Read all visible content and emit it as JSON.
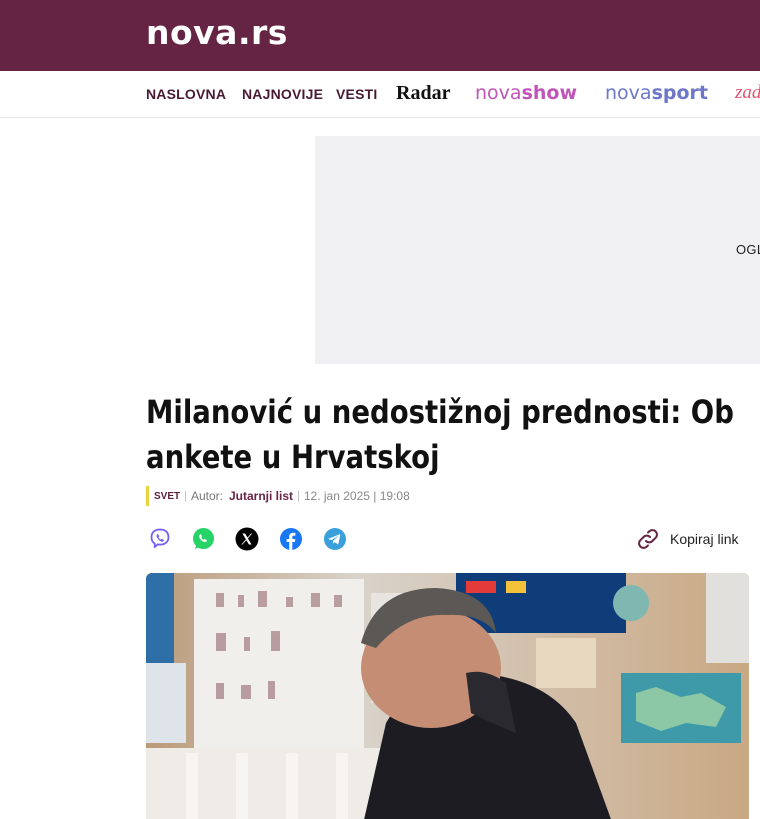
{
  "header": {
    "logo": "nova.rs",
    "bg_color": "#652443"
  },
  "nav": {
    "items": [
      "NASLOVNA",
      "NAJNOVIJE",
      "VESTI"
    ],
    "radar": "Radar",
    "novashow": {
      "prefix": "nova",
      "suffix": "show"
    },
    "novasport": {
      "prefix": "nova",
      "suffix": "sport"
    },
    "cutoff": "zad"
  },
  "ad": {
    "label": "OGL"
  },
  "article": {
    "title_line1": "Milanović u nedostižnoj prednosti: Ob",
    "title_line2": "ankete u Hrvatskoj",
    "category": "SVET",
    "author_label": "Autor:",
    "author": "Jutarnji list",
    "date": "12. jan 2025 | 19:08"
  },
  "share": {
    "icons": [
      "viber-icon",
      "whatsapp-icon",
      "x-icon",
      "facebook-icon",
      "telegram-icon"
    ],
    "copy_label": "Kopiraj link"
  },
  "colors": {
    "brand": "#652443",
    "category_bar": "#e7d33a",
    "novashow": "#c054b8",
    "novasport": "#6c77c8"
  }
}
